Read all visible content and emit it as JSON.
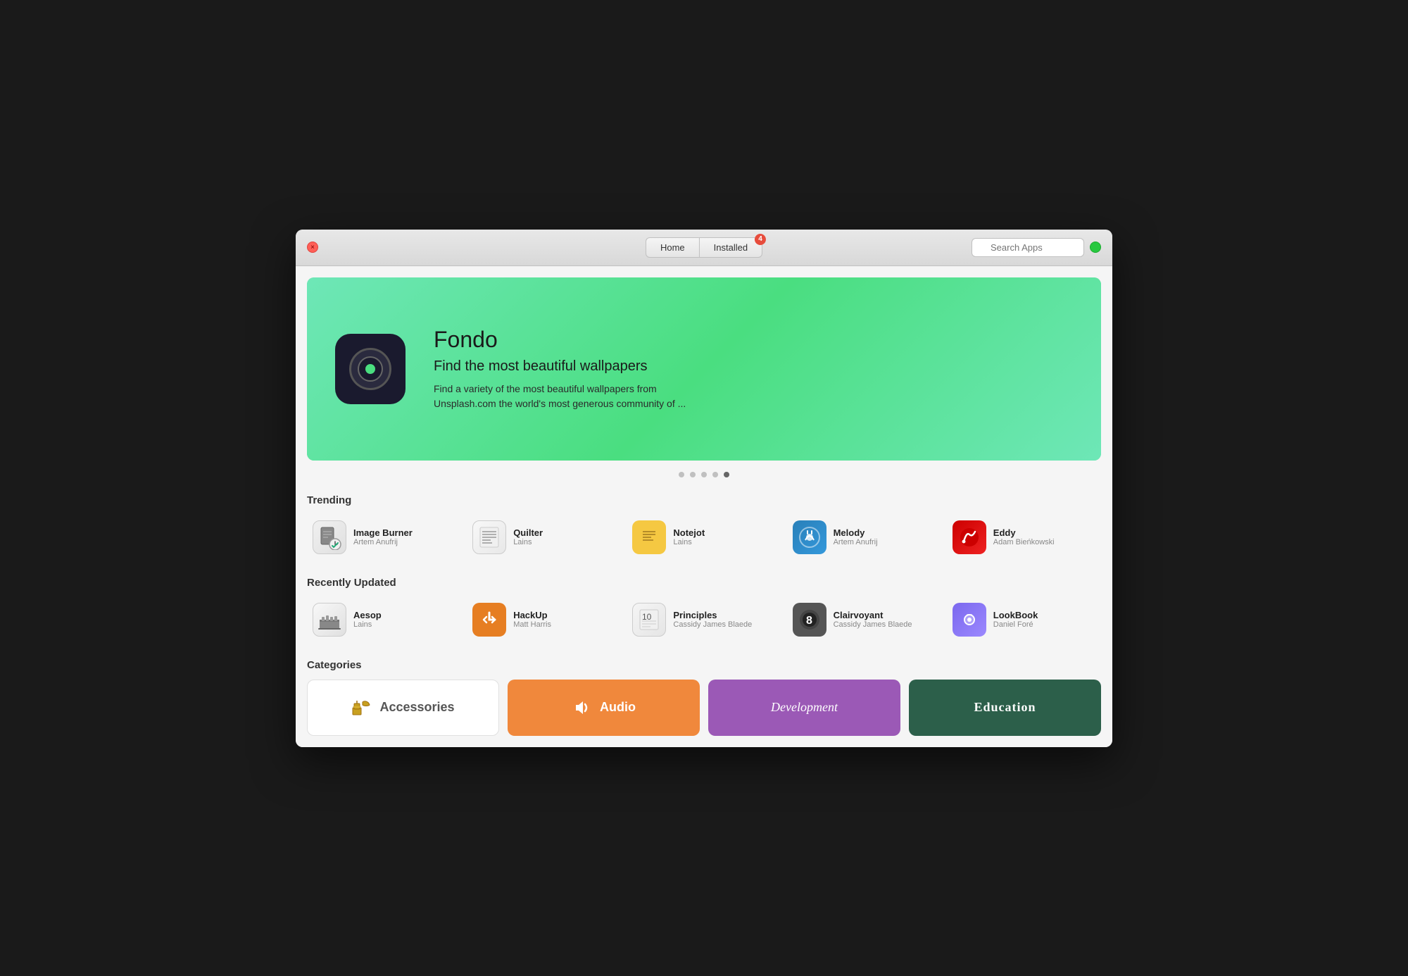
{
  "window": {
    "close_label": "×"
  },
  "titlebar": {
    "nav": {
      "home_label": "Home",
      "installed_label": "Installed",
      "installed_badge": "4"
    },
    "search_placeholder": "Search Apps"
  },
  "hero": {
    "app_name": "Fondo",
    "tagline": "Find the most beautiful wallpapers",
    "description": "Find a variety of the most beautiful wallpapers from\nUnsplash.com the world's most generous community of ..."
  },
  "trending": {
    "section_title": "Trending",
    "apps": [
      {
        "name": "Image Burner",
        "author": "Artem Anufrij"
      },
      {
        "name": "Quilter",
        "author": "Lains"
      },
      {
        "name": "Notejot",
        "author": "Lains"
      },
      {
        "name": "Melody",
        "author": "Artem Anufrij"
      },
      {
        "name": "Eddy",
        "author": "Adam Bieńkowski"
      }
    ]
  },
  "recently_updated": {
    "section_title": "Recently Updated",
    "apps": [
      {
        "name": "Aesop",
        "author": "Lains"
      },
      {
        "name": "HackUp",
        "author": "Matt Harris"
      },
      {
        "name": "Principles",
        "author": "Cassidy James Blaede"
      },
      {
        "name": "Clairvoyant",
        "author": "Cassidy James Blaede"
      },
      {
        "name": "LookBook",
        "author": "Daniel Foré"
      }
    ]
  },
  "categories": {
    "section_title": "Categories",
    "items": [
      {
        "name": "Accessories",
        "color": "white",
        "type": "accessories"
      },
      {
        "name": "Audio",
        "color": "#f0883c",
        "type": "audio"
      },
      {
        "name": "Development",
        "color": "#9b59b6",
        "type": "development"
      },
      {
        "name": "Education",
        "color": "#2c5f4a",
        "type": "education"
      }
    ]
  }
}
